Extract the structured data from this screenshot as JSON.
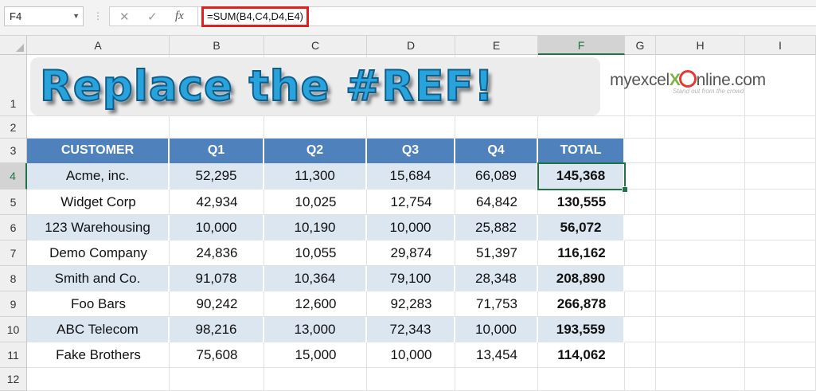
{
  "formula_bar": {
    "name_box": "F4",
    "cancel_icon": "✕",
    "enter_icon": "✓",
    "fx_label": "fx",
    "formula": "=SUM(B4,C4,D4,E4)"
  },
  "columns": [
    "A",
    "B",
    "C",
    "D",
    "E",
    "F",
    "G",
    "H",
    "I"
  ],
  "rows": [
    "1",
    "2",
    "3",
    "4",
    "5",
    "6",
    "7",
    "8",
    "9",
    "10",
    "11",
    "12"
  ],
  "selected_cell": "F4",
  "banner": {
    "title": "Replace the #REF!"
  },
  "logo": {
    "part1": "myexcel",
    "x": "X",
    "part2": "nline.com",
    "tagline": "Stand out from the crowd"
  },
  "table": {
    "headers": [
      "CUSTOMER",
      "Q1",
      "Q2",
      "Q3",
      "Q4",
      "TOTAL"
    ],
    "rows": [
      [
        "Acme, inc.",
        "52,295",
        "11,300",
        "15,684",
        "66,089",
        "145,368"
      ],
      [
        "Widget Corp",
        "42,934",
        "10,025",
        "12,754",
        "64,842",
        "130,555"
      ],
      [
        "123 Warehousing",
        "10,000",
        "10,190",
        "10,000",
        "25,882",
        "56,072"
      ],
      [
        "Demo Company",
        "24,836",
        "10,055",
        "29,874",
        "51,397",
        "116,162"
      ],
      [
        "Smith and Co.",
        "91,078",
        "10,364",
        "79,100",
        "28,348",
        "208,890"
      ],
      [
        "Foo Bars",
        "90,242",
        "12,600",
        "92,283",
        "71,753",
        "266,878"
      ],
      [
        "ABC Telecom",
        "98,216",
        "13,000",
        "72,343",
        "10,000",
        "193,559"
      ],
      [
        "Fake Brothers",
        "75,608",
        "15,000",
        "10,000",
        "13,454",
        "114,062"
      ]
    ]
  },
  "colors": {
    "header_blue": "#4f81bd",
    "band": "#dce6f1",
    "selection_green": "#217346",
    "formula_highlight": "#e0201e"
  }
}
